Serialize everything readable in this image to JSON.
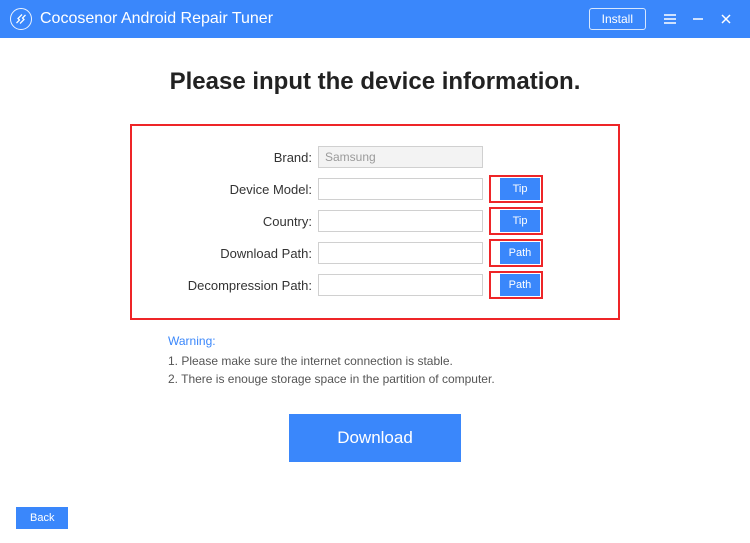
{
  "titlebar": {
    "app_name": "Cocosenor Android Repair Tuner",
    "install_label": "Install"
  },
  "heading": "Please input the device information.",
  "form": {
    "brand_label": "Brand:",
    "brand_value": "Samsung",
    "device_model_label": "Device Model:",
    "device_model_value": "",
    "device_model_btn": "Tip",
    "country_label": "Country:",
    "country_value": "",
    "country_btn": "Tip",
    "download_path_label": "Download Path:",
    "download_path_value": "",
    "download_path_btn": "Path",
    "decompression_path_label": "Decompression Path:",
    "decompression_path_value": "",
    "decompression_path_btn": "Path"
  },
  "warning": {
    "title": "Warning:",
    "line1": "1. Please make sure the internet connection is stable.",
    "line2": "2. There is enouge storage space in the partition of computer."
  },
  "download_label": "Download",
  "back_label": "Back"
}
